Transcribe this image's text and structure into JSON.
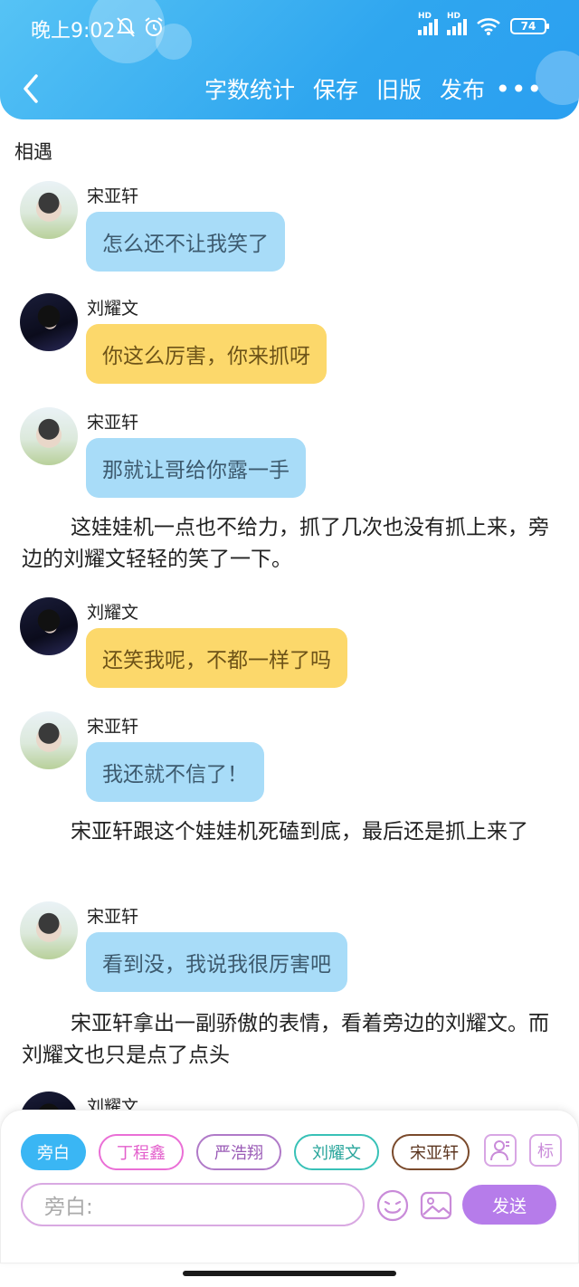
{
  "status_bar": {
    "time": "晚上9:02",
    "battery": "74",
    "icons": [
      "mute-bell-icon",
      "alarm-icon",
      "signal-hd-icon",
      "signal-hd-icon",
      "wifi-icon",
      "battery-icon"
    ]
  },
  "nav": {
    "back_icon": "chevron-left-icon",
    "items": [
      "字数统计",
      "保存",
      "旧版",
      "发布"
    ],
    "more": "•••"
  },
  "colors": {
    "header": "#2fa6ef",
    "bubble_blue": "#a8dcf8",
    "bubble_yellow": "#fcd86b",
    "send": "#b67cea"
  },
  "chapter": {
    "title": "相遇"
  },
  "messages": [
    {
      "speaker": "宋亚轩",
      "text": "怎么还不让我笑了",
      "color": "blue"
    },
    {
      "speaker": "刘耀文",
      "text": "你这么厉害，你来抓呀",
      "color": "yellow"
    },
    {
      "speaker": "宋亚轩",
      "text": "那就让哥给你露一手",
      "color": "blue"
    },
    {
      "speaker": "刘耀文",
      "text": "还笑我呢，不都一样了吗",
      "color": "yellow"
    },
    {
      "speaker": "宋亚轩",
      "text": "我还就不信了！",
      "color": "blue"
    },
    {
      "speaker": "宋亚轩",
      "text": "看到没，我说我很厉害吧",
      "color": "blue"
    },
    {
      "speaker": "刘耀文",
      "text": "",
      "color": "yellow"
    }
  ],
  "narrations": [
    "这娃娃机一点也不给力，抓了几次也没有抓上来，旁边的刘耀文轻轻的笑了一下。",
    "宋亚轩跟这个娃娃机死磕到底，最后还是抓上来了",
    "宋亚轩拿出一副骄傲的表情，看着旁边的刘耀文。而刘耀文也只是点了点头"
  ],
  "composer": {
    "roles": [
      "旁白",
      "丁程鑫",
      "严浩翔",
      "刘耀文",
      "宋亚轩"
    ],
    "selected_role": "旁白",
    "tag_label": "标",
    "input_placeholder": "旁白:",
    "send_label": "发送"
  }
}
